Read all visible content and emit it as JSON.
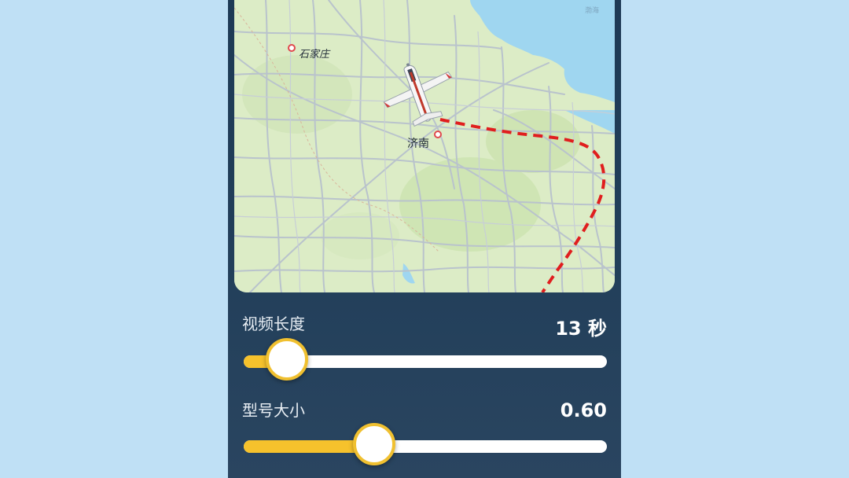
{
  "map": {
    "cities": [
      "石家庄",
      "济南"
    ],
    "sea_label": "渤海",
    "plane_icon": "airplane-icon",
    "route_color": "#e01e1e"
  },
  "controls": {
    "duration": {
      "label": "视频长度",
      "value_text": "13 秒",
      "level": 0.12
    },
    "size": {
      "label": "型号大小",
      "value_text": "0.60",
      "level": 0.36
    }
  },
  "colors": {
    "background": "#bfe0f5",
    "panel": "#1d3a55",
    "accent": "#f6c22c"
  }
}
